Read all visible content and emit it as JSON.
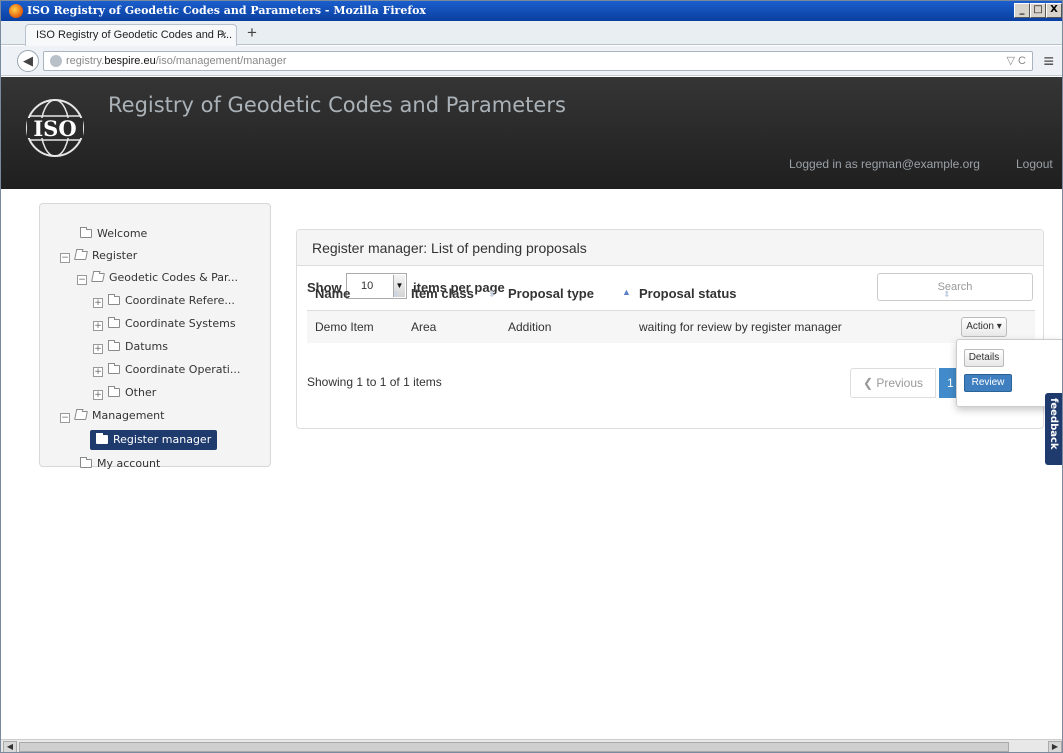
{
  "window": {
    "title": "ISO Registry of Geodetic Codes and Parameters - Mozilla Firefox",
    "btn_min": "_",
    "btn_max": "□",
    "btn_close": "X"
  },
  "browser": {
    "tab_title": "ISO Registry of Geodetic Codes and P...",
    "tab_close": "×",
    "new_tab": "+",
    "url_domain_prefix": "registry.",
    "url_domain": "bespire.eu",
    "url_path": "/iso/management/manager",
    "url_right": "▽ C"
  },
  "header": {
    "logo_text": "ISO",
    "site_title": "Registry of Geodetic Codes and Parameters",
    "logged_in": "Logged in as regman@example.org",
    "logout": "Logout"
  },
  "sidebar": {
    "items": [
      {
        "label": "Welcome"
      },
      {
        "label": "Register"
      },
      {
        "label": "Geodetic Codes & Par..."
      },
      {
        "label": "Coordinate Refere..."
      },
      {
        "label": "Coordinate Systems"
      },
      {
        "label": "Datums"
      },
      {
        "label": "Coordinate Operati..."
      },
      {
        "label": "Other"
      },
      {
        "label": "Management"
      },
      {
        "label": "Register manager"
      },
      {
        "label": "My account"
      }
    ]
  },
  "panel": {
    "title": "Register manager: List of pending proposals",
    "show_label": "Show",
    "items_per_page": "10",
    "items_per_page_label": "items per page",
    "search_placeholder": "Search",
    "columns": [
      "Name",
      "Item class",
      "Proposal type",
      "Proposal status"
    ],
    "rows": [
      {
        "name": "Demo Item",
        "item_class": "Area",
        "proposal_type": "Addition",
        "proposal_status": "waiting for review by register manager",
        "action": "Action ▾"
      }
    ],
    "info": "Showing 1 to 1 of 1 items",
    "prev": "❮ Previous",
    "page": "1"
  },
  "dropdown": {
    "details": "Details",
    "review": "Review"
  },
  "feedback": "feedback"
}
